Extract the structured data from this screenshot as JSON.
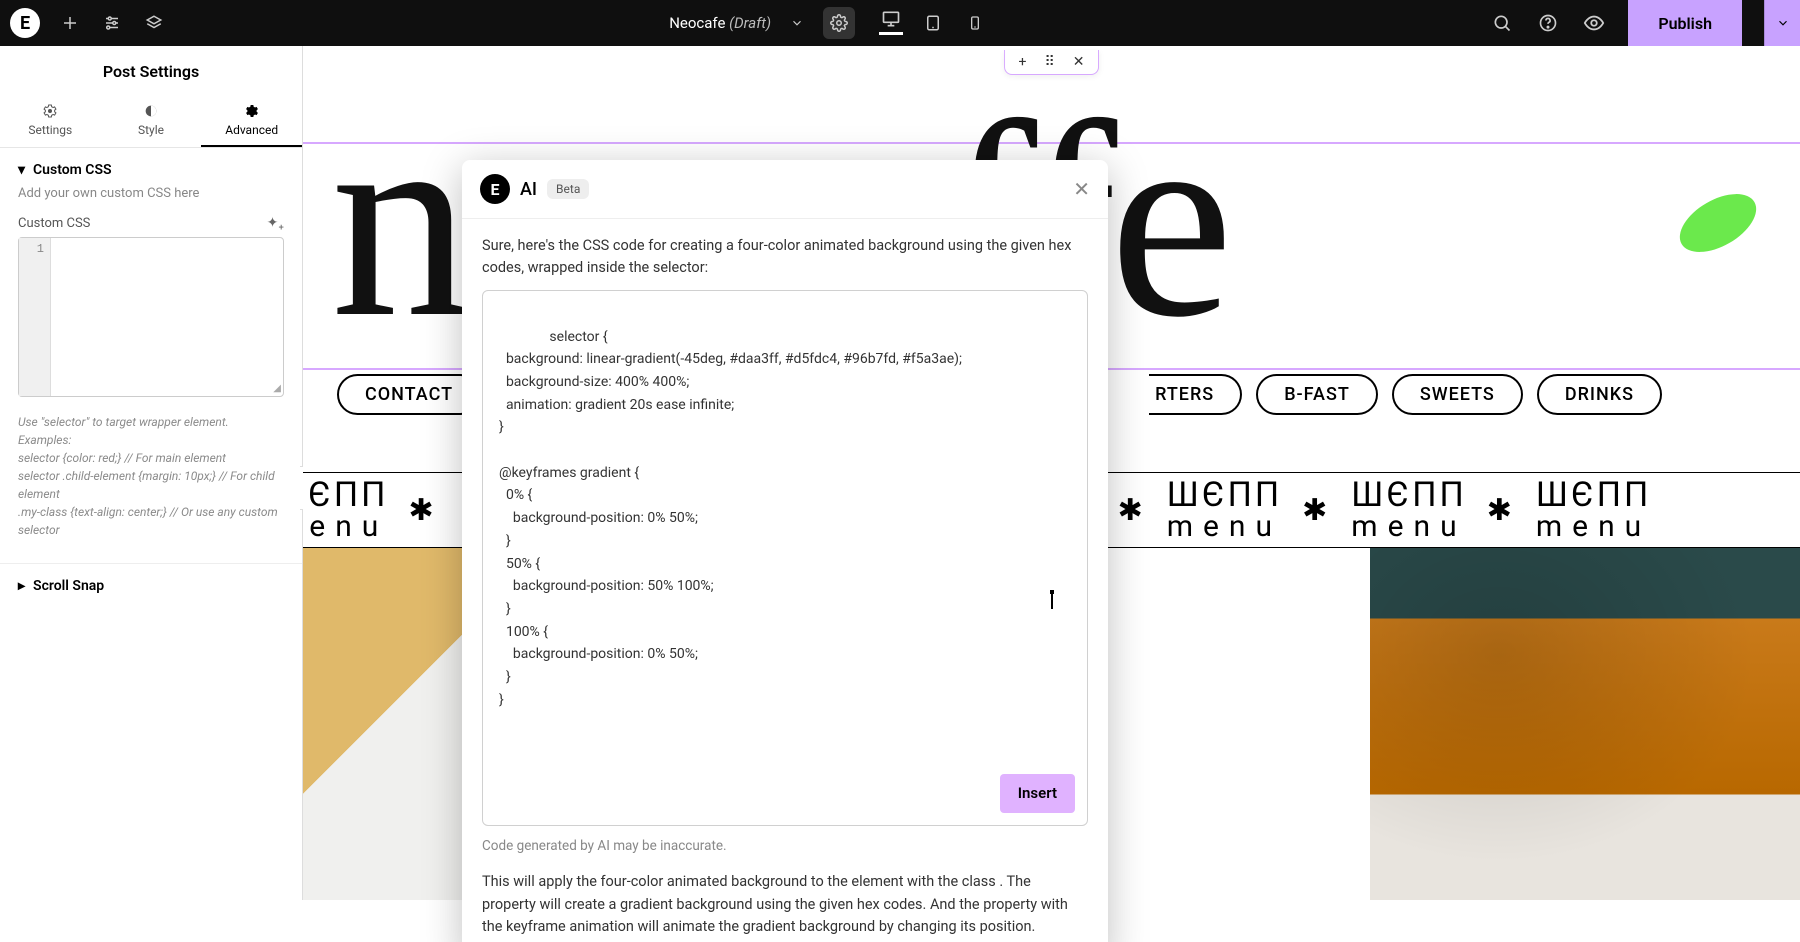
{
  "topbar": {
    "doc_name": "Neocafe",
    "doc_status": "(Draft)",
    "publish_label": "Publish"
  },
  "sidebar": {
    "panel_title": "Post Settings",
    "tabs": {
      "settings": "Settings",
      "style": "Style",
      "advanced": "Advanced"
    },
    "section_css": "Custom CSS",
    "hint": "Add your own custom CSS here",
    "field_label": "Custom CSS",
    "gutter_1": "1",
    "help_text": "Use \"selector\" to target wrapper element. Examples:\nselector {color: red;} // For main element\nselector .child-element {margin: 10px;} // For child element\n.my-class {text-align: center;} // Or use any custom selector",
    "section_scroll": "Scroll Snap"
  },
  "canvas": {
    "big_text": "neocaffe",
    "pills": [
      "CONTACT",
      "",
      "RTERS",
      "B-FAST",
      "SWEETS",
      "DRINKS"
    ],
    "marquee_top": "ШЄПП",
    "marquee_bottom": "menu",
    "toolbox": {
      "add": "+",
      "drag": "⠿",
      "close": "✕"
    }
  },
  "ai_modal": {
    "title": "AI",
    "badge": "Beta",
    "intro": "Sure, here's the CSS code for creating a four-color animated background using the given hex codes, wrapped inside the selector:",
    "code": "selector {\n  background: linear-gradient(-45deg, #daa3ff, #d5fdc4, #96b7fd, #f5a3ae);\n  background-size: 400% 400%;\n  animation: gradient 20s ease infinite;\n}\n\n@keyframes gradient {\n  0% {\n    background-position: 0% 50%;\n  }\n  50% {\n    background-position: 50% 100%;\n  }\n  100% {\n    background-position: 0% 50%;\n  }\n}",
    "insert": "Insert",
    "disclaimer": "Code generated by AI may be inaccurate.",
    "explain": "This will apply the four-color animated background to the element with the class . The property will create a gradient background using the given hex codes. And the property with the keyframe animation will animate the gradient background by changing its position."
  }
}
